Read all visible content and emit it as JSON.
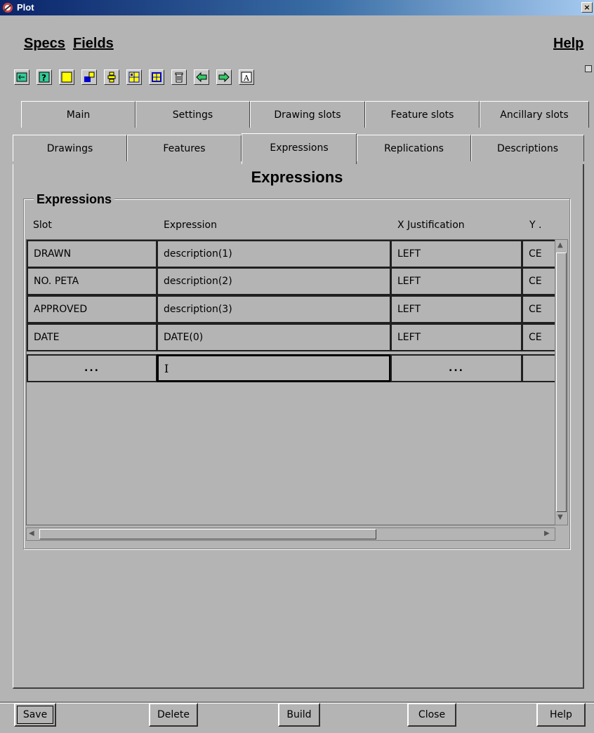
{
  "window": {
    "title": "Plot",
    "close_glyph": "×"
  },
  "menu": {
    "specs": "Specs",
    "fields": "Fields",
    "help": "Help"
  },
  "toolbar": {
    "icons": [
      "text-frame-icon",
      "help-question-icon",
      "rectangle-icon",
      "move-feature-icon",
      "align-icon",
      "grid-icon",
      "select-area-icon",
      "delete-bin-icon",
      "arrow-left-icon",
      "arrow-right-icon",
      "text-A-icon"
    ]
  },
  "tabs": {
    "row1": [
      "Main",
      "Settings",
      "Drawing slots",
      "Feature slots",
      "Ancillary slots"
    ],
    "row2": [
      "Drawings",
      "Features",
      "Expressions",
      "Replications",
      "Descriptions"
    ],
    "active": "Expressions"
  },
  "page": {
    "title": "Expressions"
  },
  "group": {
    "title": "Expressions"
  },
  "table": {
    "headers": {
      "slot": "Slot",
      "expression": "Expression",
      "xjust": "X Justification",
      "yjust": "Y ."
    },
    "rows": [
      {
        "slot": "DRAWN",
        "expression": "description(1)",
        "xjust": "LEFT",
        "yjust": "CE"
      },
      {
        "slot": "NO. PETA",
        "expression": "description(2)",
        "xjust": "LEFT",
        "yjust": "CE"
      },
      {
        "slot": "APPROVED",
        "expression": "description(3)",
        "xjust": "LEFT",
        "yjust": "CE"
      },
      {
        "slot": "DATE",
        "expression": "DATE(0)",
        "xjust": "LEFT",
        "yjust": "CE"
      }
    ],
    "new_row": {
      "slot": "...",
      "expression": "",
      "xjust": "...",
      "yjust": ""
    }
  },
  "buttons": {
    "save": "Save",
    "delete": "Delete",
    "build": "Build",
    "close": "Close",
    "help": "Help"
  }
}
